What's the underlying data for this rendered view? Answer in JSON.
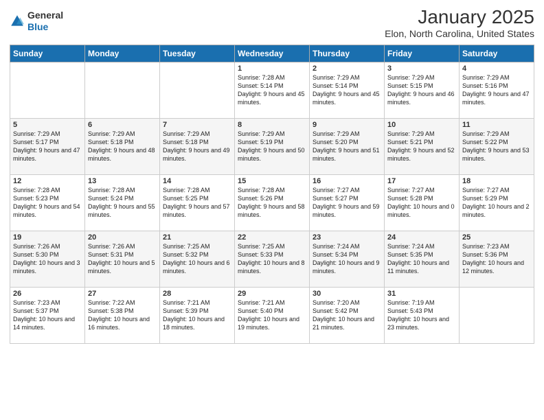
{
  "logo": {
    "text_general": "General",
    "text_blue": "Blue"
  },
  "title": "January 2025",
  "subtitle": "Elon, North Carolina, United States",
  "days_of_week": [
    "Sunday",
    "Monday",
    "Tuesday",
    "Wednesday",
    "Thursday",
    "Friday",
    "Saturday"
  ],
  "weeks": [
    [
      {
        "day": "",
        "info": ""
      },
      {
        "day": "",
        "info": ""
      },
      {
        "day": "",
        "info": ""
      },
      {
        "day": "1",
        "info": "Sunrise: 7:28 AM\nSunset: 5:14 PM\nDaylight: 9 hours and 45 minutes."
      },
      {
        "day": "2",
        "info": "Sunrise: 7:29 AM\nSunset: 5:14 PM\nDaylight: 9 hours and 45 minutes."
      },
      {
        "day": "3",
        "info": "Sunrise: 7:29 AM\nSunset: 5:15 PM\nDaylight: 9 hours and 46 minutes."
      },
      {
        "day": "4",
        "info": "Sunrise: 7:29 AM\nSunset: 5:16 PM\nDaylight: 9 hours and 47 minutes."
      }
    ],
    [
      {
        "day": "5",
        "info": "Sunrise: 7:29 AM\nSunset: 5:17 PM\nDaylight: 9 hours and 47 minutes."
      },
      {
        "day": "6",
        "info": "Sunrise: 7:29 AM\nSunset: 5:18 PM\nDaylight: 9 hours and 48 minutes."
      },
      {
        "day": "7",
        "info": "Sunrise: 7:29 AM\nSunset: 5:18 PM\nDaylight: 9 hours and 49 minutes."
      },
      {
        "day": "8",
        "info": "Sunrise: 7:29 AM\nSunset: 5:19 PM\nDaylight: 9 hours and 50 minutes."
      },
      {
        "day": "9",
        "info": "Sunrise: 7:29 AM\nSunset: 5:20 PM\nDaylight: 9 hours and 51 minutes."
      },
      {
        "day": "10",
        "info": "Sunrise: 7:29 AM\nSunset: 5:21 PM\nDaylight: 9 hours and 52 minutes."
      },
      {
        "day": "11",
        "info": "Sunrise: 7:29 AM\nSunset: 5:22 PM\nDaylight: 9 hours and 53 minutes."
      }
    ],
    [
      {
        "day": "12",
        "info": "Sunrise: 7:28 AM\nSunset: 5:23 PM\nDaylight: 9 hours and 54 minutes."
      },
      {
        "day": "13",
        "info": "Sunrise: 7:28 AM\nSunset: 5:24 PM\nDaylight: 9 hours and 55 minutes."
      },
      {
        "day": "14",
        "info": "Sunrise: 7:28 AM\nSunset: 5:25 PM\nDaylight: 9 hours and 57 minutes."
      },
      {
        "day": "15",
        "info": "Sunrise: 7:28 AM\nSunset: 5:26 PM\nDaylight: 9 hours and 58 minutes."
      },
      {
        "day": "16",
        "info": "Sunrise: 7:27 AM\nSunset: 5:27 PM\nDaylight: 9 hours and 59 minutes."
      },
      {
        "day": "17",
        "info": "Sunrise: 7:27 AM\nSunset: 5:28 PM\nDaylight: 10 hours and 0 minutes."
      },
      {
        "day": "18",
        "info": "Sunrise: 7:27 AM\nSunset: 5:29 PM\nDaylight: 10 hours and 2 minutes."
      }
    ],
    [
      {
        "day": "19",
        "info": "Sunrise: 7:26 AM\nSunset: 5:30 PM\nDaylight: 10 hours and 3 minutes."
      },
      {
        "day": "20",
        "info": "Sunrise: 7:26 AM\nSunset: 5:31 PM\nDaylight: 10 hours and 5 minutes."
      },
      {
        "day": "21",
        "info": "Sunrise: 7:25 AM\nSunset: 5:32 PM\nDaylight: 10 hours and 6 minutes."
      },
      {
        "day": "22",
        "info": "Sunrise: 7:25 AM\nSunset: 5:33 PM\nDaylight: 10 hours and 8 minutes."
      },
      {
        "day": "23",
        "info": "Sunrise: 7:24 AM\nSunset: 5:34 PM\nDaylight: 10 hours and 9 minutes."
      },
      {
        "day": "24",
        "info": "Sunrise: 7:24 AM\nSunset: 5:35 PM\nDaylight: 10 hours and 11 minutes."
      },
      {
        "day": "25",
        "info": "Sunrise: 7:23 AM\nSunset: 5:36 PM\nDaylight: 10 hours and 12 minutes."
      }
    ],
    [
      {
        "day": "26",
        "info": "Sunrise: 7:23 AM\nSunset: 5:37 PM\nDaylight: 10 hours and 14 minutes."
      },
      {
        "day": "27",
        "info": "Sunrise: 7:22 AM\nSunset: 5:38 PM\nDaylight: 10 hours and 16 minutes."
      },
      {
        "day": "28",
        "info": "Sunrise: 7:21 AM\nSunset: 5:39 PM\nDaylight: 10 hours and 18 minutes."
      },
      {
        "day": "29",
        "info": "Sunrise: 7:21 AM\nSunset: 5:40 PM\nDaylight: 10 hours and 19 minutes."
      },
      {
        "day": "30",
        "info": "Sunrise: 7:20 AM\nSunset: 5:42 PM\nDaylight: 10 hours and 21 minutes."
      },
      {
        "day": "31",
        "info": "Sunrise: 7:19 AM\nSunset: 5:43 PM\nDaylight: 10 hours and 23 minutes."
      },
      {
        "day": "",
        "info": ""
      }
    ]
  ]
}
